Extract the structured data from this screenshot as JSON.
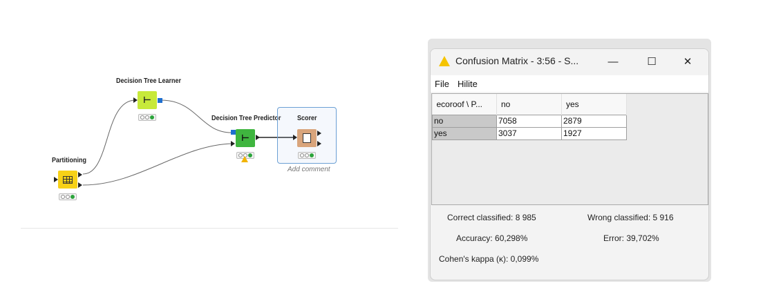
{
  "workflow": {
    "nodes": {
      "partitioning": {
        "label": "Partitioning",
        "icon": "table-grid-icon",
        "color": "#f7d117"
      },
      "learner": {
        "label": "Decision Tree Learner",
        "icon": "decision-tree-icon",
        "color": "#c7e93a"
      },
      "predictor": {
        "label": "Decision Tree Predictor",
        "icon": "predictor-icon",
        "color": "#3fb53f"
      },
      "scorer": {
        "label": "Scorer",
        "icon": "scorer-icon",
        "color": "#d9a57c",
        "comment": "Add comment"
      }
    }
  },
  "window": {
    "title": "Confusion Matrix - 3:56 - S...",
    "minimize": "—",
    "maximize": "☐",
    "close": "✕",
    "menu": [
      "File",
      "Hilite"
    ],
    "table": {
      "corner": "ecoroof \\ P...",
      "columns": [
        "no",
        "yes"
      ],
      "rows": [
        {
          "label": "no",
          "values": [
            "7058",
            "2879"
          ]
        },
        {
          "label": "yes",
          "values": [
            "3037",
            "1927"
          ]
        }
      ]
    },
    "stats": {
      "correct": "Correct classified: 8 985",
      "wrong": "Wrong classified: 5 916",
      "accuracy": "Accuracy: 60,298%",
      "error": "Error: 39,702%",
      "kappa": "Cohen's kappa (κ): 0,099%"
    }
  }
}
